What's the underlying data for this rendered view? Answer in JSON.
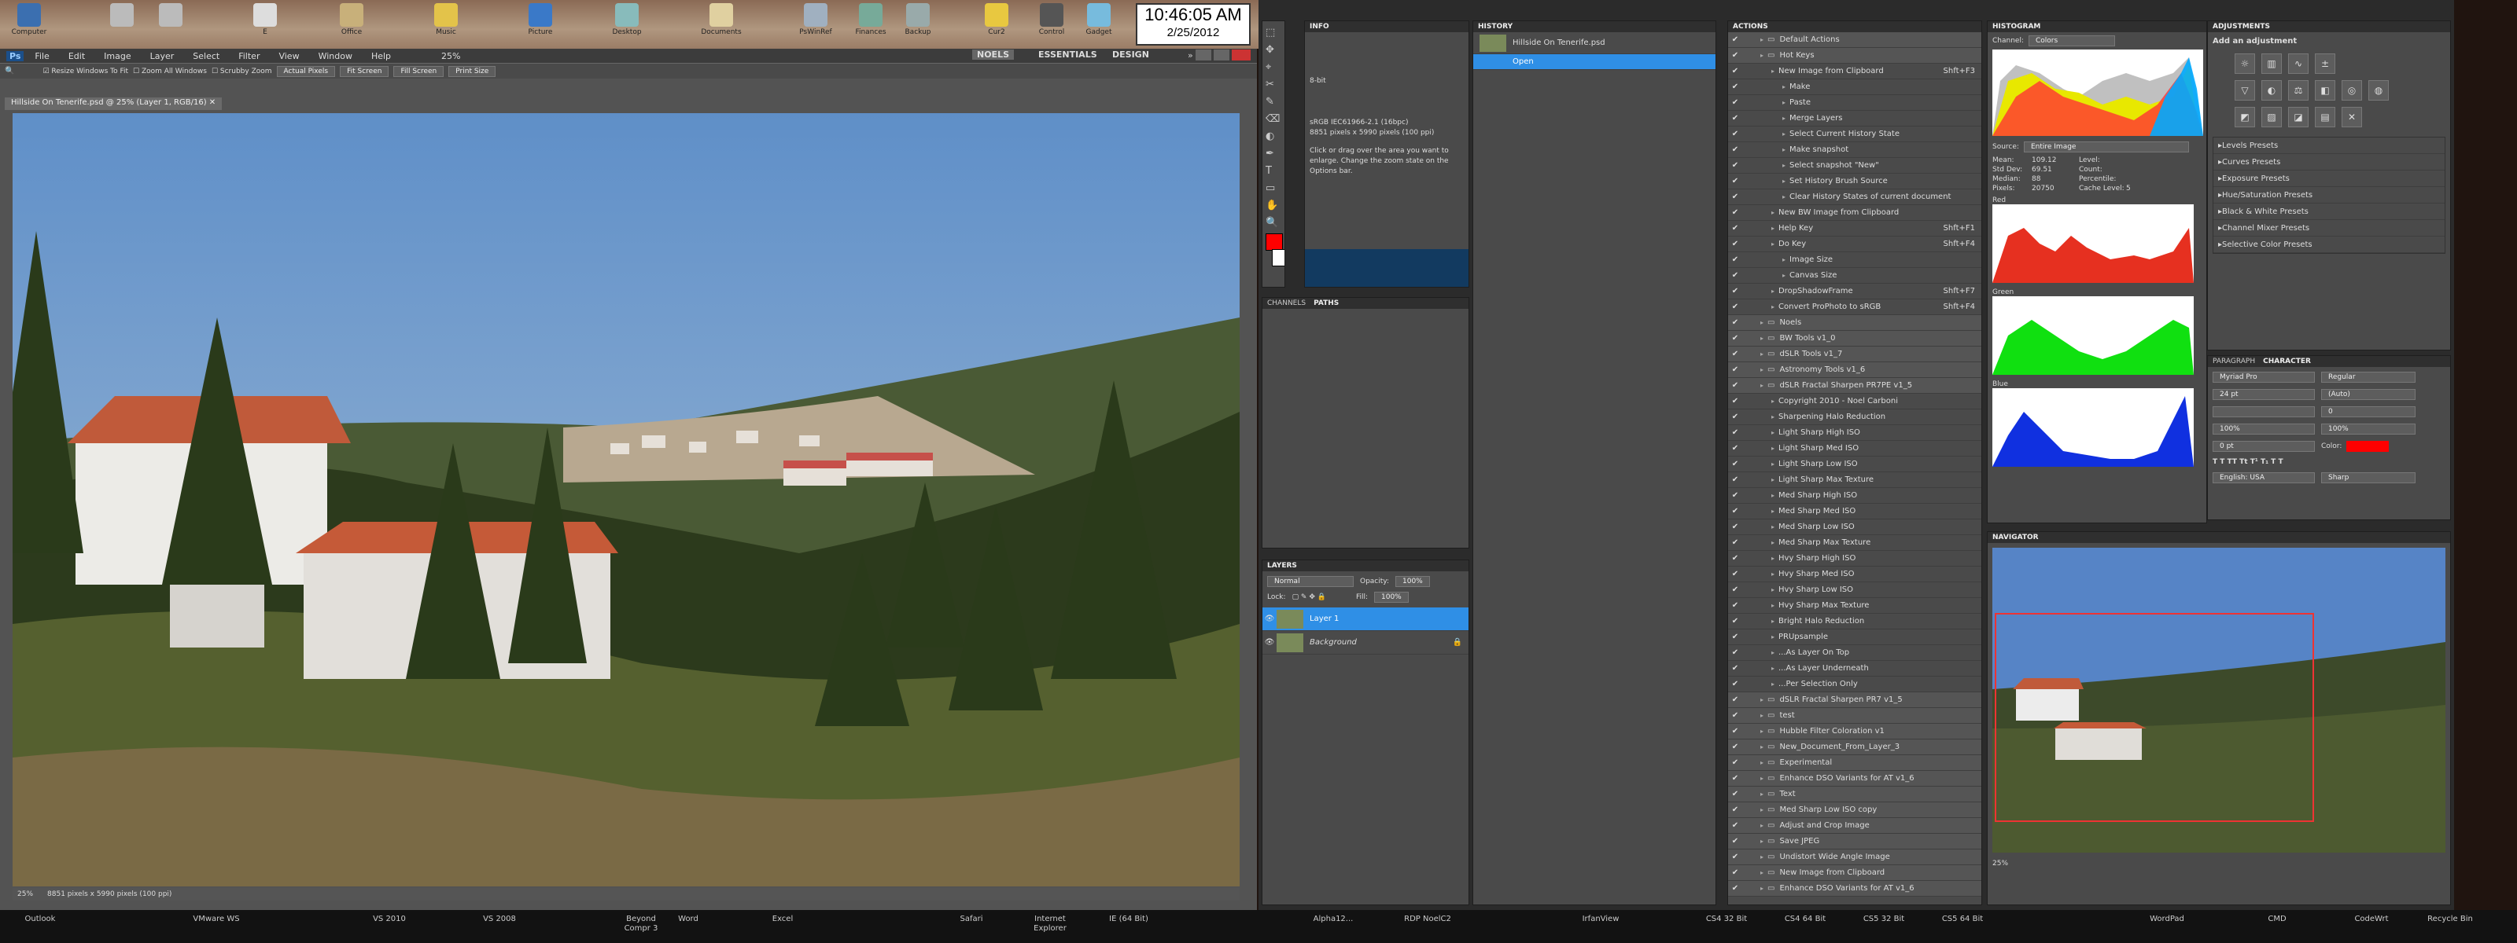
{
  "desktop_icons": [
    {
      "label": "Computer",
      "x": "computer"
    },
    {
      "label": "",
      "x": "drive1"
    },
    {
      "label": "",
      "x": "drive2"
    },
    {
      "label": "E",
      "x": "disc"
    },
    {
      "label": "Office",
      "x": "office"
    },
    {
      "label": "Music",
      "x": "music"
    },
    {
      "label": "Picture",
      "x": "pictures"
    },
    {
      "label": "Desktop",
      "x": "desktop"
    },
    {
      "label": "Documents",
      "x": "documents"
    },
    {
      "label": "PsWinRef",
      "x": "pswinref"
    },
    {
      "label": "Finances",
      "x": "finances"
    },
    {
      "label": "Backup",
      "x": "backup"
    },
    {
      "label": "Cur2",
      "x": "cur2"
    },
    {
      "label": "Control",
      "x": "control"
    },
    {
      "label": "Gadget",
      "x": "gadget"
    }
  ],
  "clock": {
    "time": "10:46:05 AM",
    "date": "2/25/2012"
  },
  "ps_menu": [
    "File",
    "Edit",
    "Image",
    "Layer",
    "Select",
    "Filter",
    "View",
    "Window",
    "Help"
  ],
  "ps_zoom": "25%",
  "workspaces": [
    "NOELS",
    "ESSENTIALS",
    "DESIGN"
  ],
  "options": {
    "resize": "Resize Windows To Fit",
    "zoom_all": "Zoom All Windows",
    "scrubby": "Scrubby Zoom",
    "actual": "Actual Pixels",
    "fit": "Fit Screen",
    "fill": "Fill Screen",
    "print": "Print Size"
  },
  "doc_tab": "Hillside On Tenerife.psd @ 25% (Layer 1, RGB/16)",
  "status": {
    "zoom": "25%",
    "dims": "8851 pixels x 5990 pixels (100 ppi)"
  },
  "info": {
    "title": "INFO",
    "profile": "sRGB IEC61966-2.1 (16bpc)",
    "size": "8851 pixels x 5990 pixels (100 ppi)",
    "hint": "Click or drag over the area you want to enlarge. Change the zoom state on the Options bar.",
    "bit": "8-bit"
  },
  "history": {
    "title": "HISTORY",
    "doc": "Hillside On Tenerife.psd",
    "state": "Open"
  },
  "channels_paths": [
    "CHANNELS",
    "PATHS"
  ],
  "layers": {
    "title": "LAYERS",
    "blend": "Normal",
    "opacity_label": "Opacity:",
    "opacity": "100%",
    "lock": "Lock:",
    "fill_label": "Fill:",
    "fill": "100%",
    "items": [
      "Layer 1",
      "Background"
    ]
  },
  "actions": {
    "title": "ACTIONS",
    "items": [
      {
        "n": "Default Actions",
        "lvl": 0,
        "s": ""
      },
      {
        "n": "Hot Keys",
        "lvl": 0,
        "s": ""
      },
      {
        "n": "New Image from Clipboard",
        "lvl": 1,
        "s": "Shft+F3"
      },
      {
        "n": "Make",
        "lvl": 2,
        "s": ""
      },
      {
        "n": "Paste",
        "lvl": 2,
        "s": ""
      },
      {
        "n": "Merge Layers",
        "lvl": 2,
        "s": ""
      },
      {
        "n": "Select Current History State",
        "lvl": 2,
        "s": ""
      },
      {
        "n": "Make snapshot",
        "lvl": 2,
        "s": ""
      },
      {
        "n": "Select snapshot \"New\"",
        "lvl": 2,
        "s": ""
      },
      {
        "n": "Set History Brush Source",
        "lvl": 2,
        "s": ""
      },
      {
        "n": "Clear History States of current document",
        "lvl": 2,
        "s": ""
      },
      {
        "n": "New BW Image from Clipboard",
        "lvl": 1,
        "s": ""
      },
      {
        "n": "Help Key",
        "lvl": 1,
        "s": "Shft+F1"
      },
      {
        "n": "Do Key",
        "lvl": 1,
        "s": "Shft+F4"
      },
      {
        "n": "Image Size",
        "lvl": 2,
        "s": ""
      },
      {
        "n": "Canvas Size",
        "lvl": 2,
        "s": ""
      },
      {
        "n": "DropShadowFrame",
        "lvl": 1,
        "s": "Shft+F7"
      },
      {
        "n": "Convert ProPhoto to sRGB",
        "lvl": 1,
        "s": "Shft+F4"
      },
      {
        "n": "Noels",
        "lvl": 0,
        "s": ""
      },
      {
        "n": "BW Tools v1_0",
        "lvl": 0,
        "s": ""
      },
      {
        "n": "dSLR Tools v1_7",
        "lvl": 0,
        "s": ""
      },
      {
        "n": "Astronomy Tools v1_6",
        "lvl": 0,
        "s": ""
      },
      {
        "n": "dSLR Fractal Sharpen PR7PE v1_5",
        "lvl": 0,
        "s": ""
      },
      {
        "n": "Copyright 2010 - Noel Carboni",
        "lvl": 1,
        "s": ""
      },
      {
        "n": "Sharpening Halo Reduction",
        "lvl": 1,
        "s": ""
      },
      {
        "n": "Light Sharp High ISO",
        "lvl": 1,
        "s": ""
      },
      {
        "n": "Light Sharp Med ISO",
        "lvl": 1,
        "s": ""
      },
      {
        "n": "Light Sharp Low ISO",
        "lvl": 1,
        "s": ""
      },
      {
        "n": "Light Sharp Max Texture",
        "lvl": 1,
        "s": ""
      },
      {
        "n": "Med Sharp High ISO",
        "lvl": 1,
        "s": ""
      },
      {
        "n": "Med Sharp Med ISO",
        "lvl": 1,
        "s": ""
      },
      {
        "n": "Med Sharp Low ISO",
        "lvl": 1,
        "s": ""
      },
      {
        "n": "Med Sharp Max Texture",
        "lvl": 1,
        "s": ""
      },
      {
        "n": "Hvy Sharp High ISO",
        "lvl": 1,
        "s": ""
      },
      {
        "n": "Hvy Sharp Med ISO",
        "lvl": 1,
        "s": ""
      },
      {
        "n": "Hvy Sharp Low ISO",
        "lvl": 1,
        "s": ""
      },
      {
        "n": "Hvy Sharp Max Texture",
        "lvl": 1,
        "s": ""
      },
      {
        "n": "Bright Halo Reduction",
        "lvl": 1,
        "s": ""
      },
      {
        "n": "PRUpsample",
        "lvl": 1,
        "s": ""
      },
      {
        "n": "...As Layer On Top",
        "lvl": 1,
        "s": ""
      },
      {
        "n": "...As Layer Underneath",
        "lvl": 1,
        "s": ""
      },
      {
        "n": "...Per Selection Only",
        "lvl": 1,
        "s": ""
      },
      {
        "n": "dSLR Fractal Sharpen PR7 v1_5",
        "lvl": 0,
        "s": ""
      },
      {
        "n": "test",
        "lvl": 0,
        "s": ""
      },
      {
        "n": "Hubble Filter Coloration v1",
        "lvl": 0,
        "s": ""
      },
      {
        "n": "New_Document_From_Layer_3",
        "lvl": 0,
        "s": ""
      },
      {
        "n": "Experimental",
        "lvl": 0,
        "s": ""
      },
      {
        "n": "Enhance DSO Variants for AT v1_6",
        "lvl": 0,
        "s": ""
      },
      {
        "n": "Text",
        "lvl": 0,
        "s": ""
      },
      {
        "n": "Med Sharp Low ISO copy",
        "lvl": 0,
        "s": ""
      },
      {
        "n": "Adjust and Crop Image",
        "lvl": 0,
        "s": ""
      },
      {
        "n": "Save JPEG",
        "lvl": 0,
        "s": ""
      },
      {
        "n": "Undistort Wide Angle Image",
        "lvl": 0,
        "s": ""
      },
      {
        "n": "New Image from Clipboard",
        "lvl": 0,
        "s": ""
      },
      {
        "n": "Enhance DSO Variants for AT v1_6",
        "lvl": 0,
        "s": ""
      }
    ]
  },
  "histogram": {
    "title": "HISTOGRAM",
    "channel_label": "Channel:",
    "channel": "Colors",
    "source_label": "Source:",
    "source": "Entire Image",
    "stats": {
      "mean_l": "Mean:",
      "mean": "109.12",
      "std_l": "Std Dev:",
      "std": "69.51",
      "med_l": "Median:",
      "med": "88",
      "pix_l": "Pixels:",
      "pix": "20750",
      "lvl_l": "Level:",
      "cnt_l": "Count:",
      "pct_l": "Percentile:",
      "cache_l": "Cache Level:",
      "cache": "5"
    },
    "labels": [
      "Red",
      "Green",
      "Blue"
    ]
  },
  "adjustments": {
    "title": "ADJUSTMENTS",
    "header": "Add an adjustment",
    "presets": [
      "Levels Presets",
      "Curves Presets",
      "Exposure Presets",
      "Hue/Saturation Presets",
      "Black & White Presets",
      "Channel Mixer Presets",
      "Selective Color Presets"
    ]
  },
  "character": {
    "tabs": [
      "PARAGRAPH",
      "CHARACTER"
    ],
    "font": "Myriad Pro",
    "style": "Regular",
    "size": "24 pt",
    "leading": "(Auto)",
    "kern": "",
    "track": "0",
    "vscale": "100%",
    "hscale": "100%",
    "baseline": "0 pt",
    "color_label": "Color:",
    "lang": "English: USA",
    "aa": "Sharp"
  },
  "navigator": {
    "title": "NAVIGATOR",
    "zoom": "25%"
  },
  "taskbar": [
    "Outlook",
    "VMware WS",
    "VS 2010",
    "VS 2008",
    "Beyond Compr 3",
    "Word",
    "Excel",
    "Safari",
    "Internet Explorer",
    "IE (64 Bit)",
    "Alpha12...",
    "RDP NoelC2",
    "IrfanView",
    "CS4 32 Bit",
    "CS4 64 Bit",
    "CS5 32 Bit",
    "CS5 64 Bit",
    "WordPad",
    "CMD",
    "CodeWrt",
    "Recycle Bin"
  ],
  "colors": {
    "fg": "#ff0000",
    "bg": "#ffffff",
    "select": "#2f8fe6"
  }
}
